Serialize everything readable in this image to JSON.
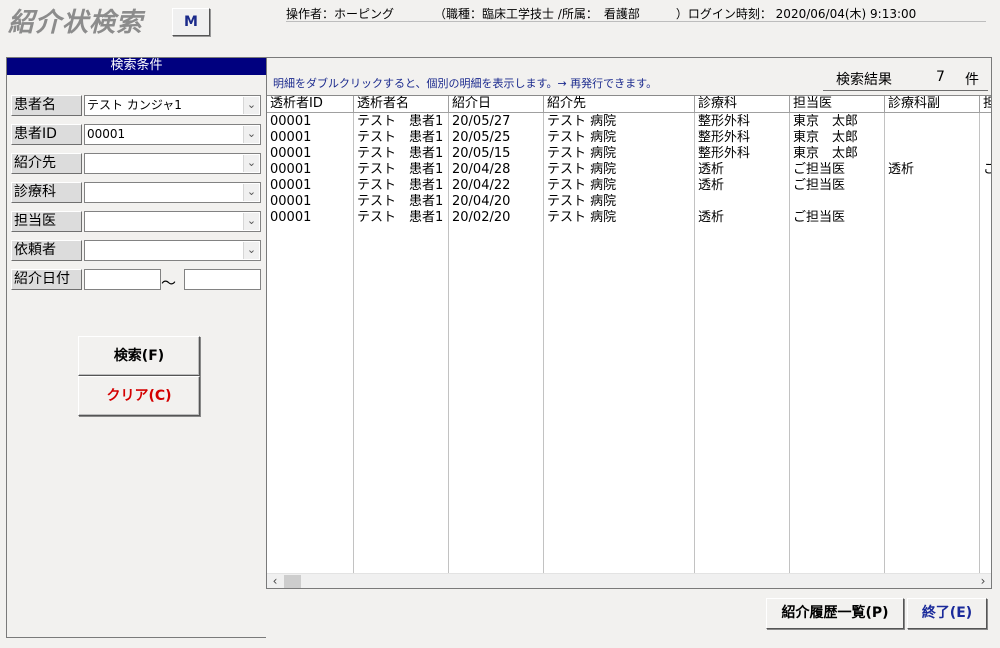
{
  "header": {
    "title": "紹介状検索",
    "menu_button": "M",
    "operator": "操作者：ホーピング",
    "role": "（職種：臨床工学技士 /所属：　看護部　　　）ログイン時刻：  2020/06/04(木) 9:13:00"
  },
  "search_panel": {
    "title": "検索条件",
    "fields": [
      {
        "label": "患者名",
        "value": "テスト カンジャ1"
      },
      {
        "label": "患者ID",
        "value": "00001"
      },
      {
        "label": "紹介先",
        "value": ""
      },
      {
        "label": "診療科",
        "value": ""
      },
      {
        "label": "担当医",
        "value": ""
      },
      {
        "label": "依頼者",
        "value": ""
      }
    ],
    "date_label": "紹介日付",
    "date_from": "",
    "date_to": "",
    "date_separator": "〜",
    "search_button": "検索(F)",
    "clear_button": "クリア(C)"
  },
  "results": {
    "instruction": "明細をダブルクリックすると、個別の明細を表示します。→ 再発行できます。",
    "count_label": "検索結果",
    "count": "7",
    "count_unit": "件",
    "columns": [
      "透析者ID",
      "透析者名",
      "紹介日",
      "紹介先",
      "診療科",
      "担当医",
      "診療科副",
      "担"
    ],
    "rows": [
      [
        "00001",
        "テスト　患者1",
        "20/05/27",
        "テスト 病院",
        "整形外科",
        "東京　太郎",
        "",
        ""
      ],
      [
        "00001",
        "テスト　患者1",
        "20/05/25",
        "テスト 病院",
        "整形外科",
        "東京　太郎",
        "",
        ""
      ],
      [
        "00001",
        "テスト　患者1",
        "20/05/15",
        "テスト 病院",
        "整形外科",
        "東京　太郎",
        "",
        ""
      ],
      [
        "00001",
        "テスト　患者1",
        "20/04/28",
        "テスト 病院",
        "透析",
        "ご担当医",
        "透析",
        "こ"
      ],
      [
        "00001",
        "テスト　患者1",
        "20/04/22",
        "テスト 病院",
        "透析",
        "ご担当医",
        "",
        ""
      ],
      [
        "00001",
        "テスト　患者1",
        "20/04/20",
        "テスト 病院",
        "",
        "",
        "",
        ""
      ],
      [
        "00001",
        "テスト　患者1",
        "20/02/20",
        "テスト 病院",
        "透析",
        "ご担当医",
        "",
        ""
      ]
    ]
  },
  "footer": {
    "history_button": "紹介履歴一覧(P)",
    "exit_button": "終了(E)"
  },
  "colors": {
    "panel_title_bg": "#00007f",
    "instruction_text": "#1b2a8e",
    "clear_button_text": "#d40000",
    "exit_button_text": "#1a2a9a"
  }
}
